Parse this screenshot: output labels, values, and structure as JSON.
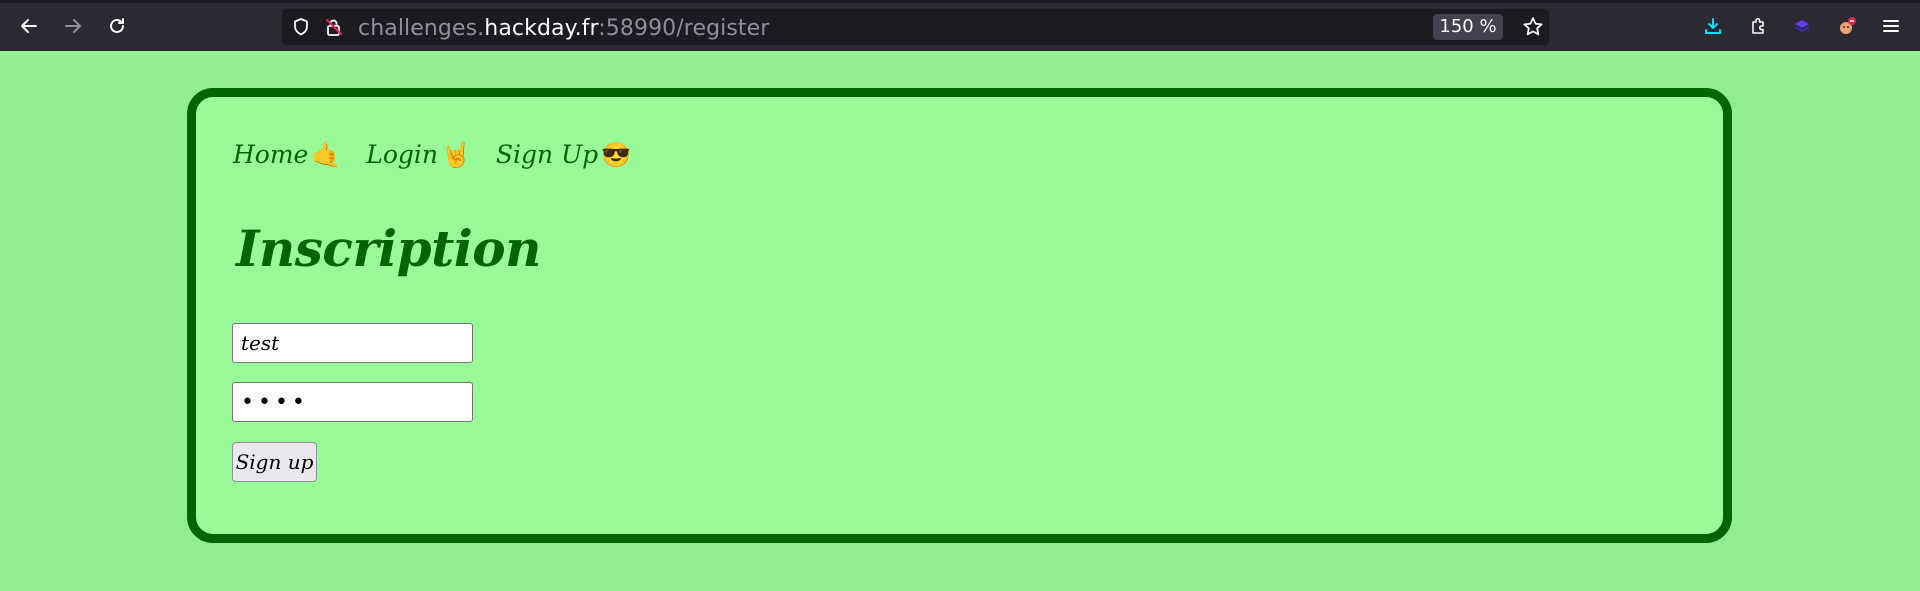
{
  "browser": {
    "url_prefix": "challenges.",
    "url_host": "hackday.fr",
    "url_suffix": ":58990/register",
    "zoom": "150 %"
  },
  "nav": {
    "items": [
      {
        "label": "Home",
        "emoji": "🤙"
      },
      {
        "label": "Login",
        "emoji": "🤘"
      },
      {
        "label": "Sign Up",
        "emoji": "😎"
      }
    ]
  },
  "page": {
    "title": "Inscription"
  },
  "form": {
    "username_value": "test",
    "password_value": "test",
    "submit_label": "Sign up"
  },
  "colors": {
    "background": "#90ee90",
    "card_background": "#98fb98",
    "accent": "#006400"
  }
}
